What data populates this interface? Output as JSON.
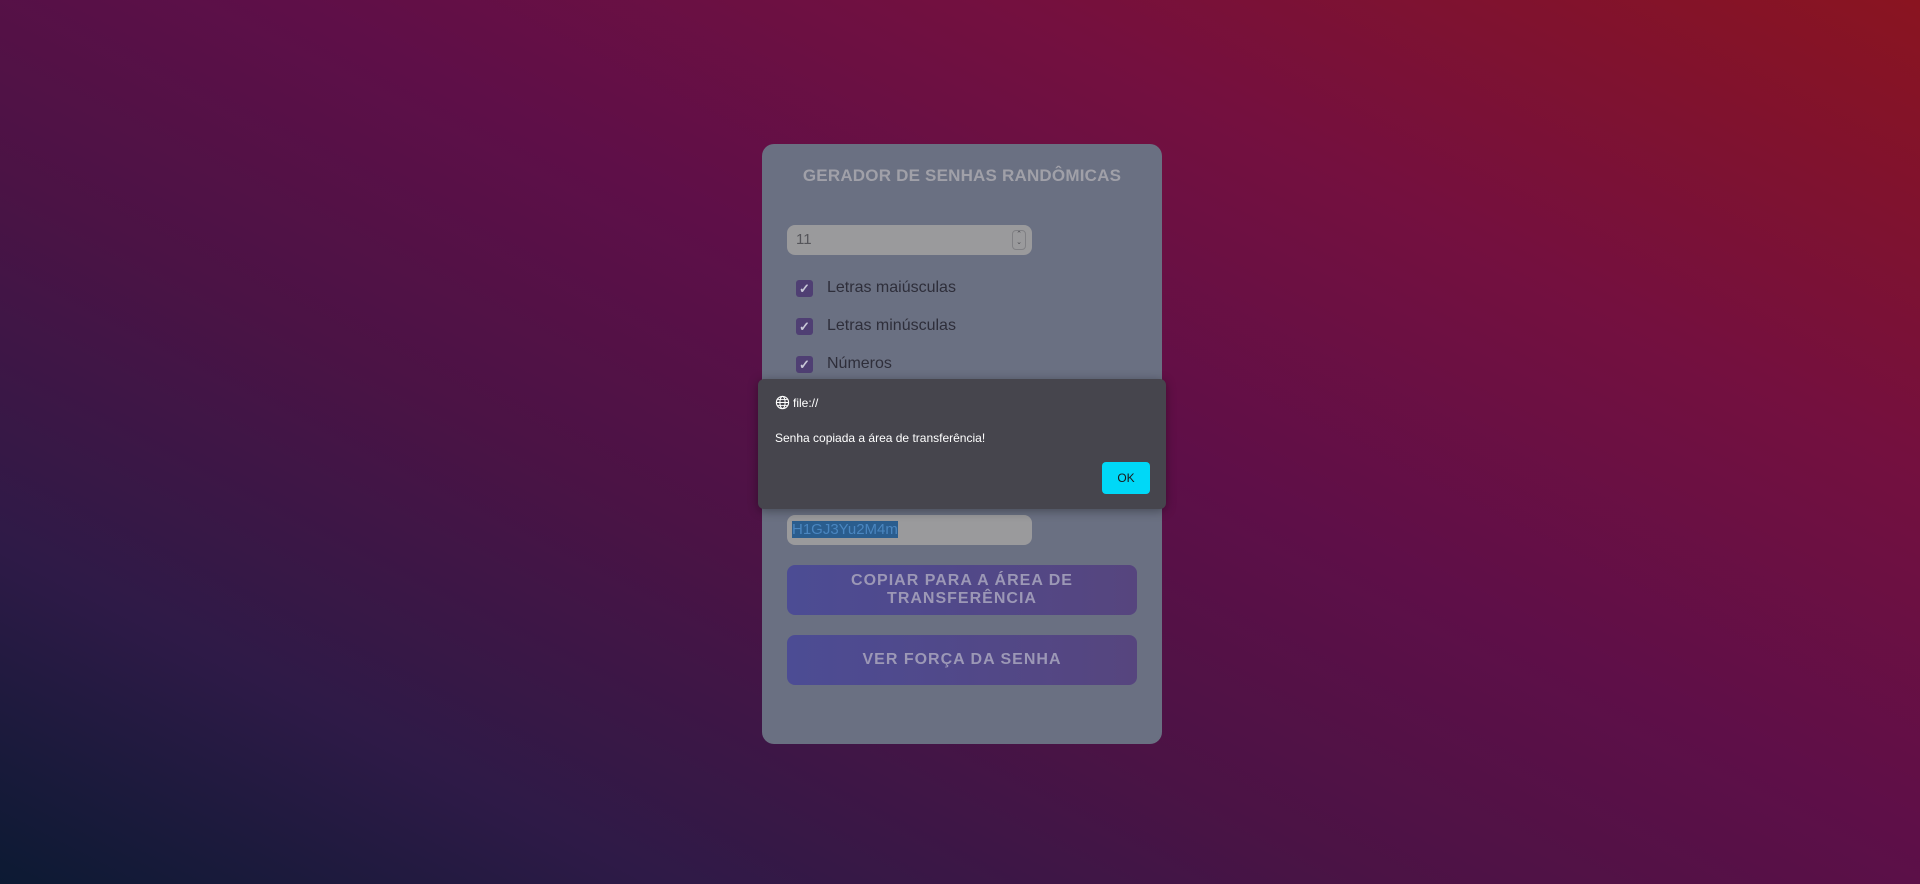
{
  "app": {
    "title": "GERADOR DE SENHAS RANDÔMICAS",
    "length_value": "11",
    "options": [
      {
        "label": "Letras maiúsculas",
        "checked": true
      },
      {
        "label": "Letras minúsculas",
        "checked": true
      },
      {
        "label": "Números",
        "checked": true
      }
    ],
    "password": "H1GJ3Yu2M4m",
    "copy_button_label": "COPIAR PARA A ÁREA DE TRANSFERÊNCIA",
    "strength_button_label": "VER FORÇA DA SENHA"
  },
  "dialog": {
    "origin": "file://",
    "message": "Senha copiada a área de transferência!",
    "ok_label": "OK",
    "accent": "#00d8f7"
  },
  "icons": {
    "checkbox": "check-icon",
    "stepper": "spin-arrows-icon",
    "origin": "globe-icon"
  }
}
